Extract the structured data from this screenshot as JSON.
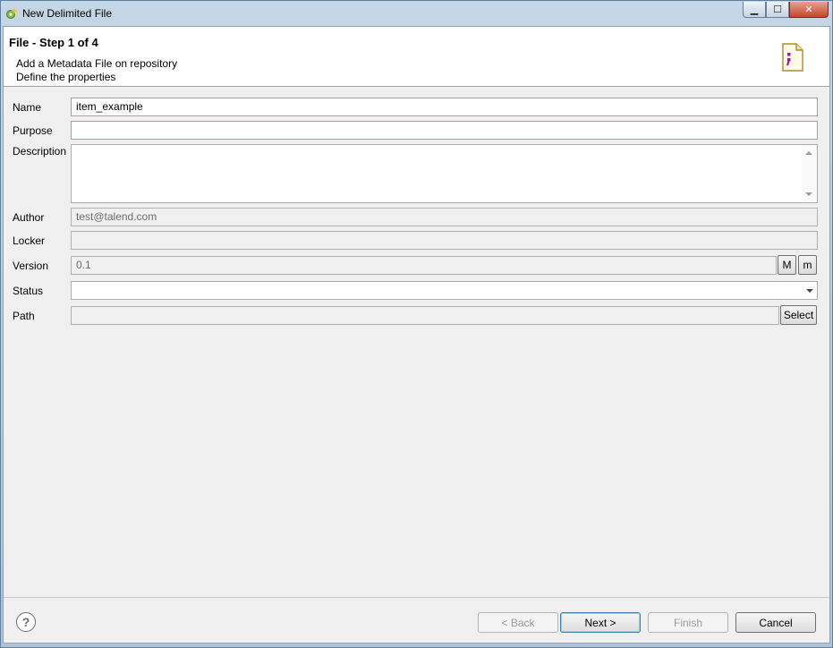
{
  "window": {
    "title": "New Delimited File",
    "controls": {
      "minimize": "▁",
      "maximize": "☐",
      "close": "✕"
    }
  },
  "header": {
    "step_title": "File - Step 1 of 4",
    "description": "Add a Metadata File on repository",
    "subtitle": "Define the properties"
  },
  "form": {
    "name": {
      "label": "Name",
      "value": "item_example"
    },
    "purpose": {
      "label": "Purpose",
      "value": ""
    },
    "description": {
      "label": "Description",
      "value": ""
    },
    "author": {
      "label": "Author",
      "value": "test@talend.com"
    },
    "locker": {
      "label": "Locker",
      "value": ""
    },
    "version": {
      "label": "Version",
      "value": "0.1",
      "major_button": "M",
      "minor_button": "m"
    },
    "status": {
      "label": "Status",
      "value": ""
    },
    "path": {
      "label": "Path",
      "value": "",
      "select_button": "Select"
    }
  },
  "footer": {
    "help": "?",
    "back_label": "< Back",
    "next_label": "Next >",
    "finish_label": "Finish",
    "cancel_label": "Cancel"
  },
  "colors": {
    "accent": "#3c7fb1",
    "file_icon_accent": "#9a1e8f"
  },
  "icons": {
    "app": "gear-sparkle-icon",
    "header": "delimited-file-icon",
    "help": "help-icon"
  }
}
